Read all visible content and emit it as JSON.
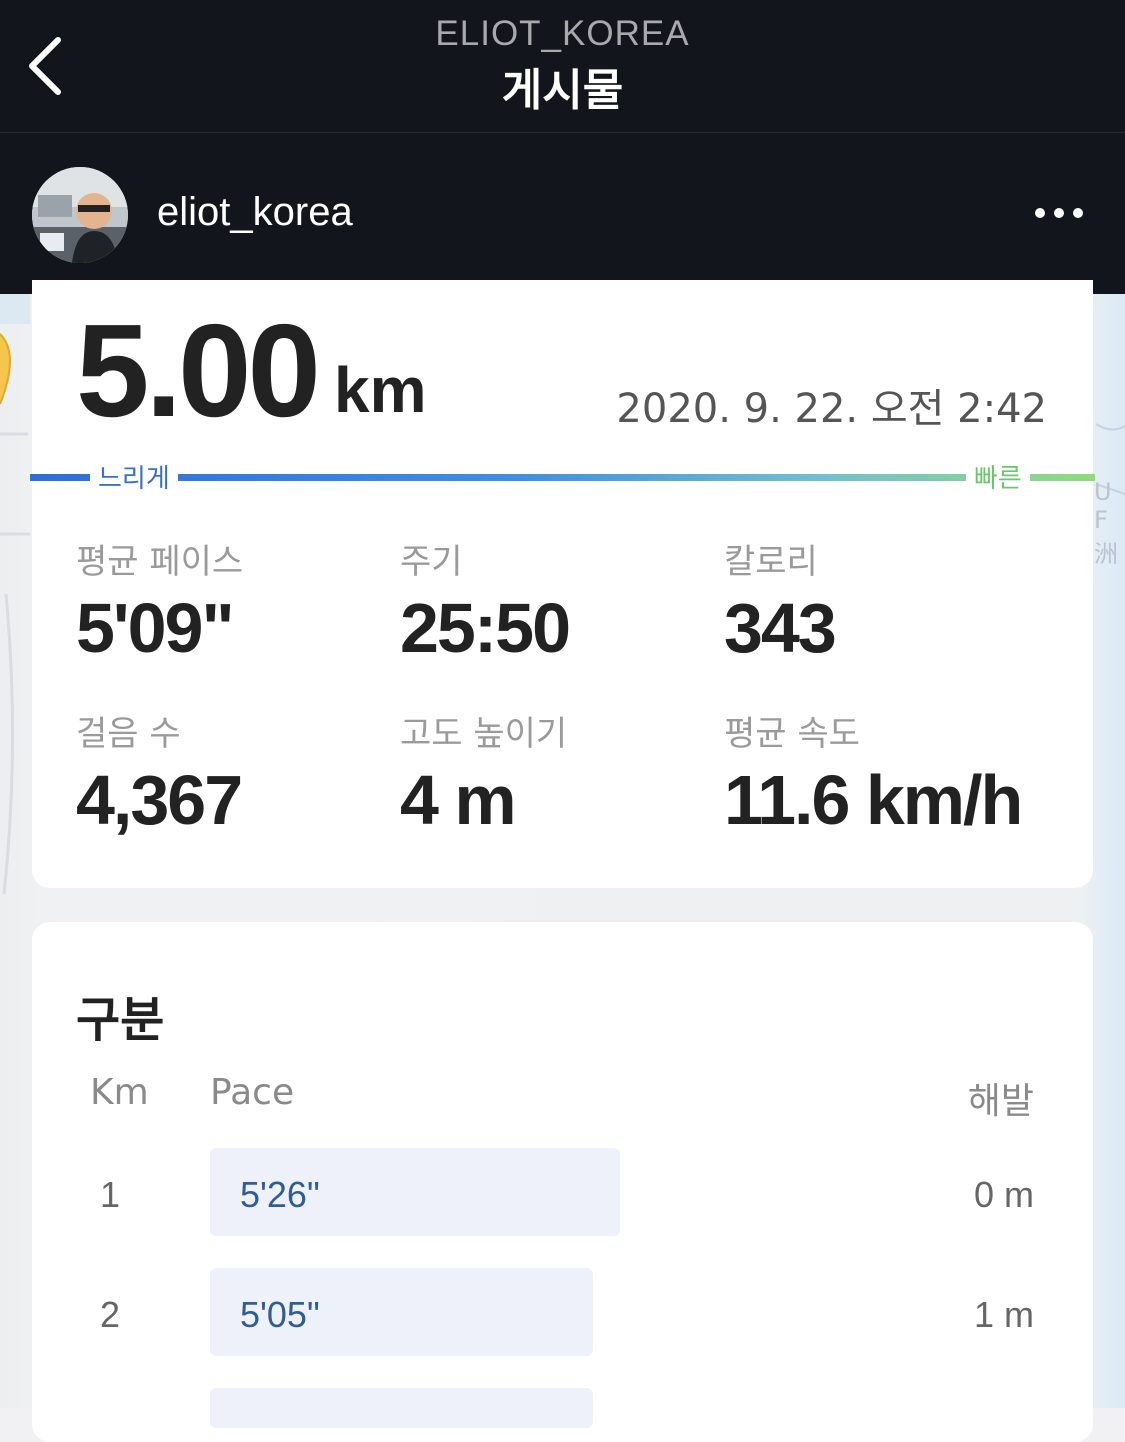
{
  "header": {
    "account": "ELIOT_KOREA",
    "title": "게시물"
  },
  "post": {
    "username": "eliot_korea"
  },
  "run": {
    "distance": "5.00",
    "distance_unit": "km",
    "datetime": "2020. 9. 22. 오전 2:42",
    "legend_slow": "느리게",
    "legend_fast": "빠른"
  },
  "stats": [
    {
      "label": "평균 페이스",
      "value": "5'09\""
    },
    {
      "label": "주기",
      "value": "25:50"
    },
    {
      "label": "칼로리",
      "value": "343"
    },
    {
      "label": "걸음 수",
      "value": "4,367"
    },
    {
      "label": "고도 높이기",
      "value": "4 m"
    },
    {
      "label": "평균 속도",
      "value": "11.6 km/h"
    }
  ],
  "splits": {
    "title": "구분",
    "col_km": "Km",
    "col_pace": "Pace",
    "col_elev": "해발",
    "rows": [
      {
        "km": "1",
        "pace": "5'26\"",
        "elev": "0 m"
      },
      {
        "km": "2",
        "pace": "5'05\"",
        "elev": "1 m"
      }
    ]
  }
}
